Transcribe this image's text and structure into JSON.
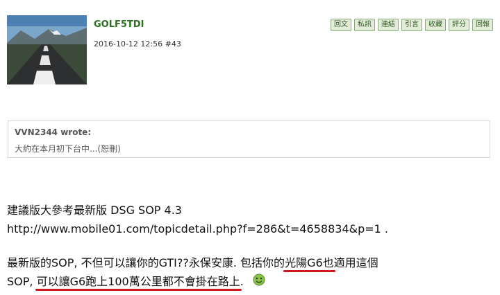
{
  "post": {
    "username": "GOLF5TDI",
    "date": "2016-10-12 12:56",
    "post_number": "#43",
    "actions": [
      "回文",
      "私訊",
      "連結",
      "引言",
      "收藏",
      "評分",
      "回報"
    ]
  },
  "quote": {
    "author": "VVN2344 wrote:",
    "text": "大約在本月初下台中...(恕刪)"
  },
  "body": {
    "line1": "建議版大參考最新版 DSG SOP 4.3",
    "line2": "http://www.mobile01.com/topicdetail.php?f=286&t=4658834&p=1 .",
    "line3_a": "最新版的SOP, 不但可以讓你的GTI??永保安康. 包括你的",
    "line3_u": "光陽G6也",
    "line3_b": "適用這個",
    "line4_a": "SOP, ",
    "line4_u": "可以讓G6跑上100萬公里都不會掛在路上",
    "line4_b": "."
  },
  "icons": {
    "smiley": "green-smiley-icon"
  },
  "colors": {
    "username": "#2b6e1f",
    "underline": "#cc1a1a",
    "button_bg": "#e3ecd9"
  }
}
